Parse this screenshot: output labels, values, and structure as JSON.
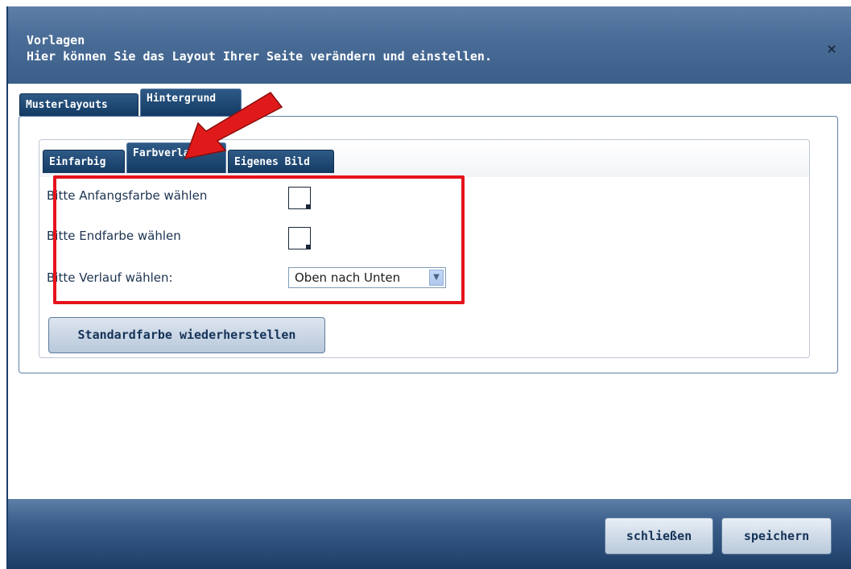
{
  "header": {
    "title": "Vorlagen",
    "subtitle": "Hier können Sie das Layout Ihrer Seite verändern und einstellen.",
    "close_icon": "×"
  },
  "outer_tabs": [
    {
      "label": "Musterlayouts"
    },
    {
      "label": "Hintergrund"
    }
  ],
  "inner_tabs": [
    {
      "label": "Einfarbig"
    },
    {
      "label": "Farbverlauf"
    },
    {
      "label": "Eigenes Bild"
    }
  ],
  "form": {
    "start_color_label": "Bitte Anfangsfarbe wählen",
    "end_color_label": "Bitte Endfarbe wählen",
    "gradient_label": "Bitte Verlauf wählen:",
    "gradient_value": "Oben nach Unten"
  },
  "buttons": {
    "reset": "Standardfarbe wiederherstellen",
    "close": "schließen",
    "save": "speichern"
  },
  "colors": {
    "accent_red": "#e5131b",
    "header_blue": "#4a6d97",
    "tab_dark": "#133a63"
  }
}
